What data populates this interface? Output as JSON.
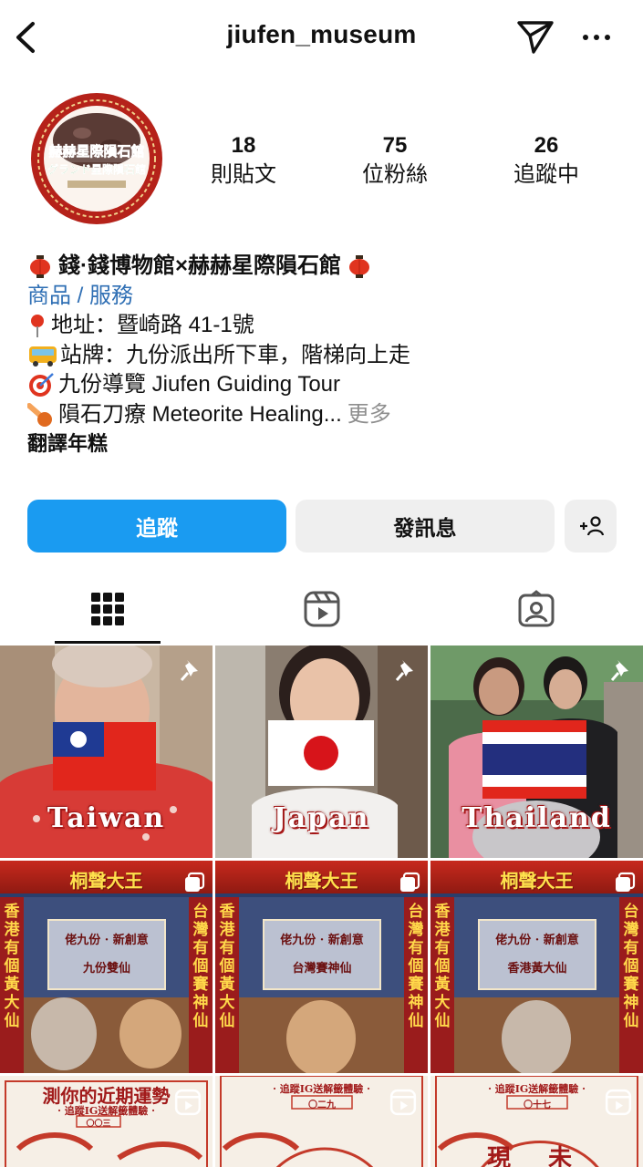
{
  "header": {
    "username": "jiufen_museum",
    "back_icon": "chevron-left-icon",
    "send_icon": "paper-plane-icon",
    "more_icon": "more-horizontal-icon"
  },
  "stats": [
    {
      "value": "18",
      "label": "則貼文"
    },
    {
      "value": "75",
      "label": "位粉絲"
    },
    {
      "value": "26",
      "label": "追蹤中"
    }
  ],
  "bio": {
    "name": "錢·錢博物館×赫赫星際隕石館",
    "category": "商品 / 服務",
    "lines": [
      {
        "icon": "pin-icon",
        "text": "地址：暨崎路 41-1號"
      },
      {
        "icon": "bus-icon",
        "text": "站牌：九份派出所下車，階梯向上走"
      },
      {
        "icon": "target-icon",
        "text": "九份導覽 Jiufen Guiding Tour"
      },
      {
        "icon": "meteor-icon",
        "text": "隕石刀療 Meteorite Healing..."
      }
    ],
    "more": "更多",
    "translate": "翻譯年糕"
  },
  "avatar": {
    "line1": "赫赫星際隕石館",
    "line2": "グランド星際隕石館"
  },
  "buttons": {
    "follow": "追蹤",
    "message": "發訊息",
    "add_user_icon": "add-user-icon"
  },
  "tabs": [
    {
      "icon": "grid-icon",
      "active": true
    },
    {
      "icon": "reels-icon",
      "active": false
    },
    {
      "icon": "tagged-icon",
      "active": false
    }
  ],
  "posts": {
    "row1": [
      {
        "label": "Taiwan",
        "pinned": true
      },
      {
        "label": "Japan",
        "pinned": true
      },
      {
        "label": "Thailand",
        "pinned": true
      }
    ],
    "row2": [
      {
        "head": "桐聲大王",
        "box_l1": "佬九份 · 新創意",
        "box_l2": "九份雙仙",
        "left_col": "香港有個黃大仙",
        "right_col": "台灣有個賽神仙"
      },
      {
        "head": "桐聲大王",
        "box_l1": "佬九份 · 新創意",
        "box_l2": "台灣賽神仙",
        "left_col": "香港有個黃大仙",
        "right_col": "台灣有個賽神仙"
      },
      {
        "head": "桐聲大王",
        "box_l1": "佬九份 · 新創意",
        "box_l2": "香港黃大仙",
        "left_col": "香港有個黃大仙",
        "right_col": "台灣有個賽神仙"
      }
    ],
    "row3": [
      {
        "title": "測你的近期運勢",
        "sub": "· 追蹤IG送解籤體驗 ·",
        "tag": "〇〇三"
      },
      {
        "title": "",
        "sub": "· 追蹤IG送解籤體驗 ·",
        "tag": "〇二九"
      },
      {
        "title": "",
        "sub": "· 追蹤IG送解籤體驗 ·",
        "tag": "〇十七",
        "big": "現 未"
      }
    ]
  }
}
